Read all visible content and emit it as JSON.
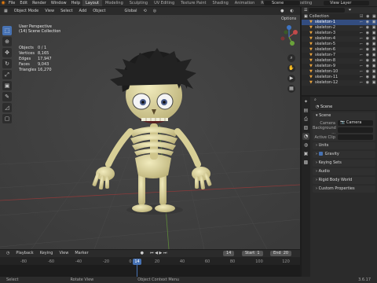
{
  "menu": {
    "items": [
      "File",
      "Edit",
      "Render",
      "Window",
      "Help"
    ],
    "workspaces": [
      "Layout",
      "Modeling",
      "Sculpting",
      "UV Editing",
      "Texture Paint",
      "Shading",
      "Animation",
      "Rendering",
      "Compositing"
    ],
    "active_workspace": "Layout",
    "scene": "Scene",
    "view_layer": "View Layer"
  },
  "viewport": {
    "mode": "Object Mode",
    "header_items": [
      "View",
      "Select",
      "Add",
      "Object"
    ],
    "transform": "Global",
    "options": "Options",
    "perspective": "User Perspective",
    "collection": "(14) Scene Collection",
    "stats": [
      {
        "k": "Objects",
        "v": "0 / 1"
      },
      {
        "k": "Vertices",
        "v": "8,165"
      },
      {
        "k": "Edges",
        "v": "17,947"
      },
      {
        "k": "Faces",
        "v": "9,043"
      },
      {
        "k": "Triangles",
        "v": "16,270"
      }
    ],
    "tools": [
      "select-box-icon",
      "cursor-icon",
      "move-icon",
      "rotate-icon",
      "scale-icon",
      "transform-icon",
      "annotate-icon",
      "measure-icon",
      "add-cube-icon"
    ]
  },
  "timeline": {
    "items": [
      "Playback",
      "Keying",
      "View",
      "Marker"
    ],
    "current_frame": "14",
    "start_label": "Start",
    "start": "1",
    "end_label": "End",
    "end": "20",
    "ticks": [
      "-80",
      "-60",
      "-40",
      "-20",
      "0",
      "20",
      "40",
      "60",
      "80",
      "100",
      "120"
    ],
    "playhead": "14"
  },
  "status": {
    "left": "Select",
    "mid1": "Rotate View",
    "mid2": "Object Context Menu",
    "version": "3.6.17"
  },
  "outliner": {
    "rows": [
      {
        "name": "Collection",
        "type": "collection"
      },
      {
        "name": "skeleton-1",
        "type": "object",
        "selected": true
      },
      {
        "name": "skeleton-2",
        "type": "object"
      },
      {
        "name": "skeleton-3",
        "type": "object"
      },
      {
        "name": "skeleton-4",
        "type": "object"
      },
      {
        "name": "skeleton-5",
        "type": "object"
      },
      {
        "name": "skeleton-6",
        "type": "object"
      },
      {
        "name": "skeleton-7",
        "type": "object"
      },
      {
        "name": "skeleton-8",
        "type": "object"
      },
      {
        "name": "skeleton-9",
        "type": "object"
      },
      {
        "name": "skeleton-10",
        "type": "object"
      },
      {
        "name": "skeleton-11",
        "type": "object"
      },
      {
        "name": "skeleton-12",
        "type": "object"
      }
    ]
  },
  "properties": {
    "context": "Scene",
    "title": "Scene",
    "panel_scene": "Scene",
    "camera_label": "Camera",
    "camera_value": "Camera",
    "background_label": "Background ...",
    "active_clip_label": "Active Clip",
    "panels": [
      "Units",
      "Gravity",
      "Keying Sets",
      "Audio",
      "Rigid Body World",
      "Custom Properties"
    ]
  },
  "colors": {
    "accent": "#4772b3",
    "blender_orange": "#e87d0d",
    "bone": "#ddd6a0"
  }
}
